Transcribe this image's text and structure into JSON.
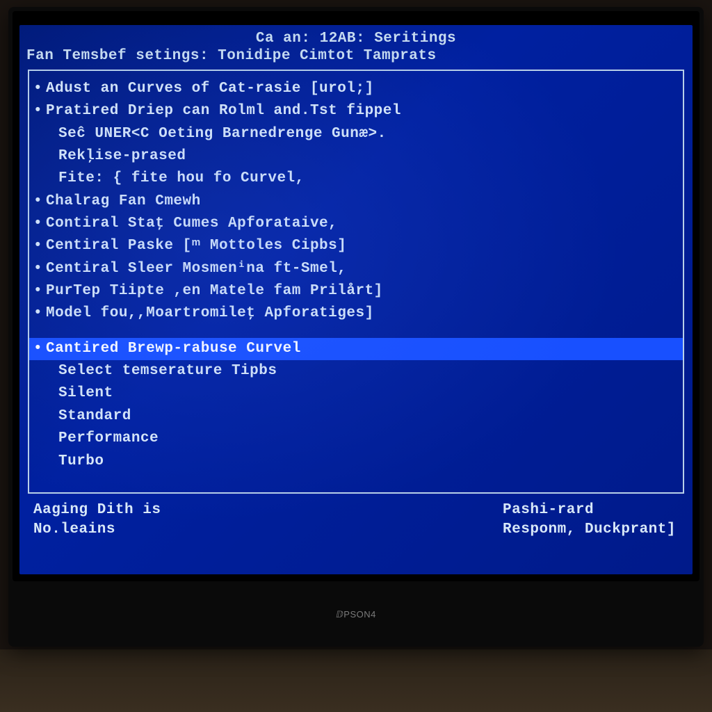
{
  "header": {
    "line1": "Ca an: 12AB: Seritings",
    "line2": "Fan Temsbef setings: Tonidipe Cimtot Tamprats"
  },
  "menu": {
    "items": [
      {
        "text": "Adust an Curves of Cat-rasie [urol;]",
        "bullet": true
      },
      {
        "text": "Pratired Driep can Rolml and.Tst fippel",
        "bullet": true
      },
      {
        "text": "Seĉ UNER<C Oeting Barnedrenge Gunæ>.",
        "bullet": false,
        "sub": true
      },
      {
        "text": "Rekļise-prased",
        "bullet": false,
        "sub": true
      },
      {
        "text": "Fite: { fite hou fo Curvel,",
        "bullet": false,
        "sub": true
      },
      {
        "text": "Chalrag Fan Cmewh",
        "bullet": true
      },
      {
        "text": "Contiral Staţ Cumes Apforataive,",
        "bullet": true
      },
      {
        "text": "Centiral Paske [ᵐ Mottoles Cipbs]",
        "bullet": true
      },
      {
        "text": "Centiral Sleer Mosmenⁱna ft-Smel,",
        "bullet": true
      },
      {
        "text": "PurTep Tiipte ,en Matele fam Prilårt]",
        "bullet": true
      },
      {
        "text": "Model fou,,Moartromileţ Apforatiges]",
        "bullet": true
      }
    ],
    "selected": "Cantired Brewp-rabuse Curvel",
    "options": [
      "Select temserature Tipbs",
      "Silent",
      "Standard",
      "Performance",
      "Turbo"
    ]
  },
  "footer": {
    "left_line1": "Aaging Dith is",
    "left_line2": "No.leains",
    "right_line1": "Pashi-rard",
    "right_line2": "Responm, Duckprant]"
  },
  "monitor_brand": "ⅅPSON4"
}
